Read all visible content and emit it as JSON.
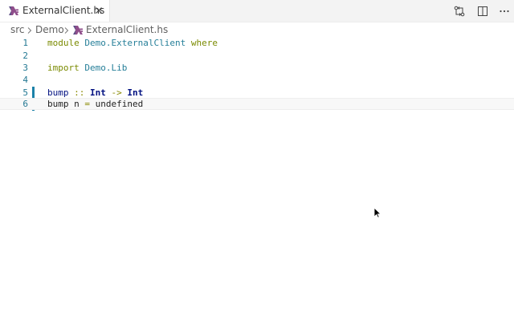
{
  "tab": {
    "title": "ExternalClient.hs",
    "icon": "haskell-file-icon",
    "close_icon": "close-icon"
  },
  "editor_actions": [
    {
      "name": "compare-changes-icon"
    },
    {
      "name": "split-editor-icon"
    },
    {
      "name": "more-actions-icon"
    }
  ],
  "breadcrumb": {
    "items": [
      "src",
      "Demo",
      "ExternalClient.hs"
    ]
  },
  "code": {
    "line_numbers": [
      "1",
      "2",
      "3",
      "4",
      "5",
      "6"
    ],
    "line1": {
      "kw1": "module",
      "mod": "Demo.ExternalClient",
      "kw2": "where"
    },
    "line3": {
      "kw": "import",
      "mod": "Demo.Lib"
    },
    "line5": {
      "fn": "bump",
      "op1": "::",
      "t1": "Int",
      "op2": "->",
      "t2": "Int"
    },
    "line6": {
      "fn": "bump",
      "arg": "n",
      "op": "=",
      "rhs": "undefined"
    }
  },
  "colors": {
    "keyword": "#7a8a00",
    "module": "#267f99",
    "line_number": "#237893",
    "modified_gutter": "#1b81a8"
  }
}
